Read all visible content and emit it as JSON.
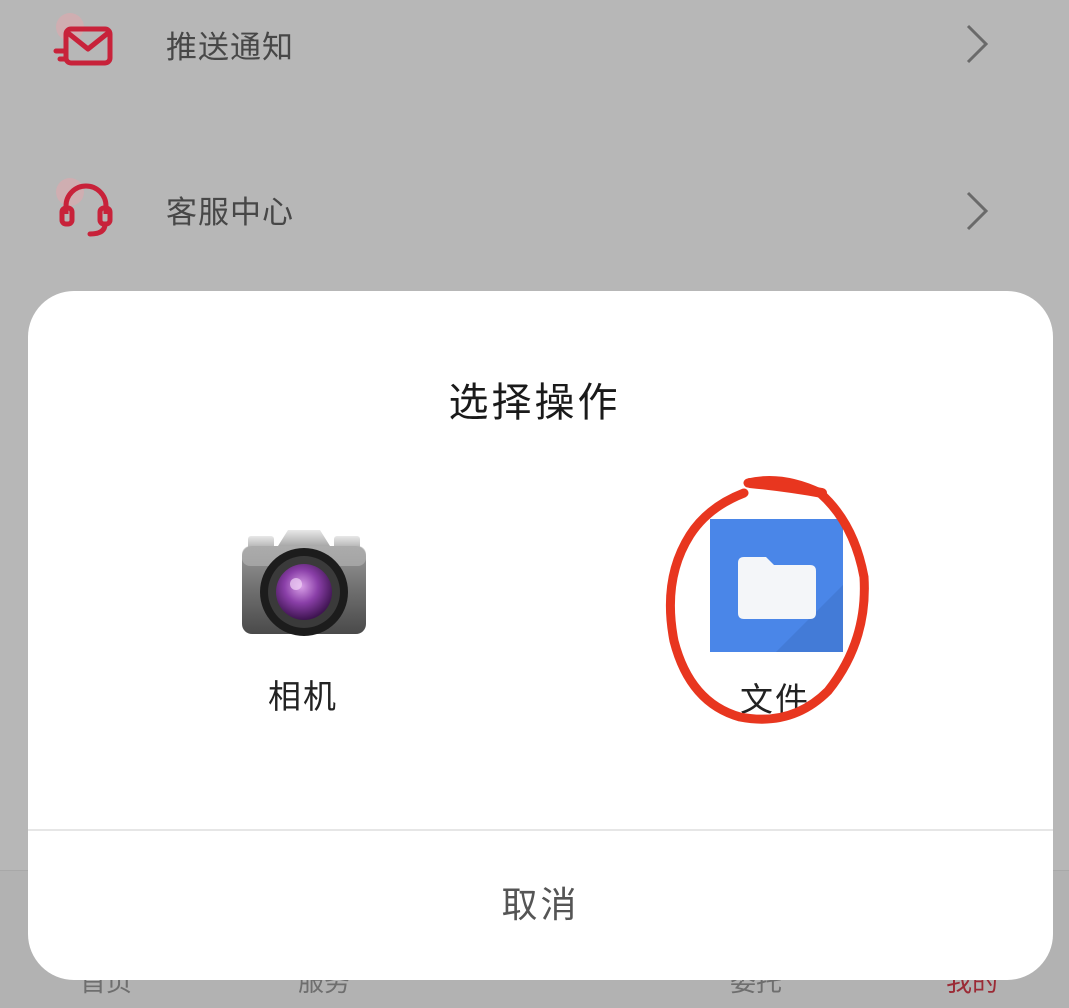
{
  "background_list": {
    "items": [
      {
        "label": "推送通知",
        "icon": "mail-icon"
      },
      {
        "label": "客服中心",
        "icon": "headset-icon"
      }
    ],
    "bottom_tabs": [
      {
        "label": "首页"
      },
      {
        "label": "服务"
      },
      {
        "label": "委托"
      },
      {
        "label": "我的"
      }
    ]
  },
  "dialog": {
    "title": "选择操作",
    "options": [
      {
        "label": "相机",
        "icon": "camera-icon"
      },
      {
        "label": "文件",
        "icon": "folder-icon"
      }
    ],
    "cancel_label": "取消"
  },
  "colors": {
    "accent_red": "#d4283c",
    "annotation_red": "#e8361f",
    "folder_blue": "#4a86e8",
    "overlay_gray": "#b7b7b7"
  }
}
